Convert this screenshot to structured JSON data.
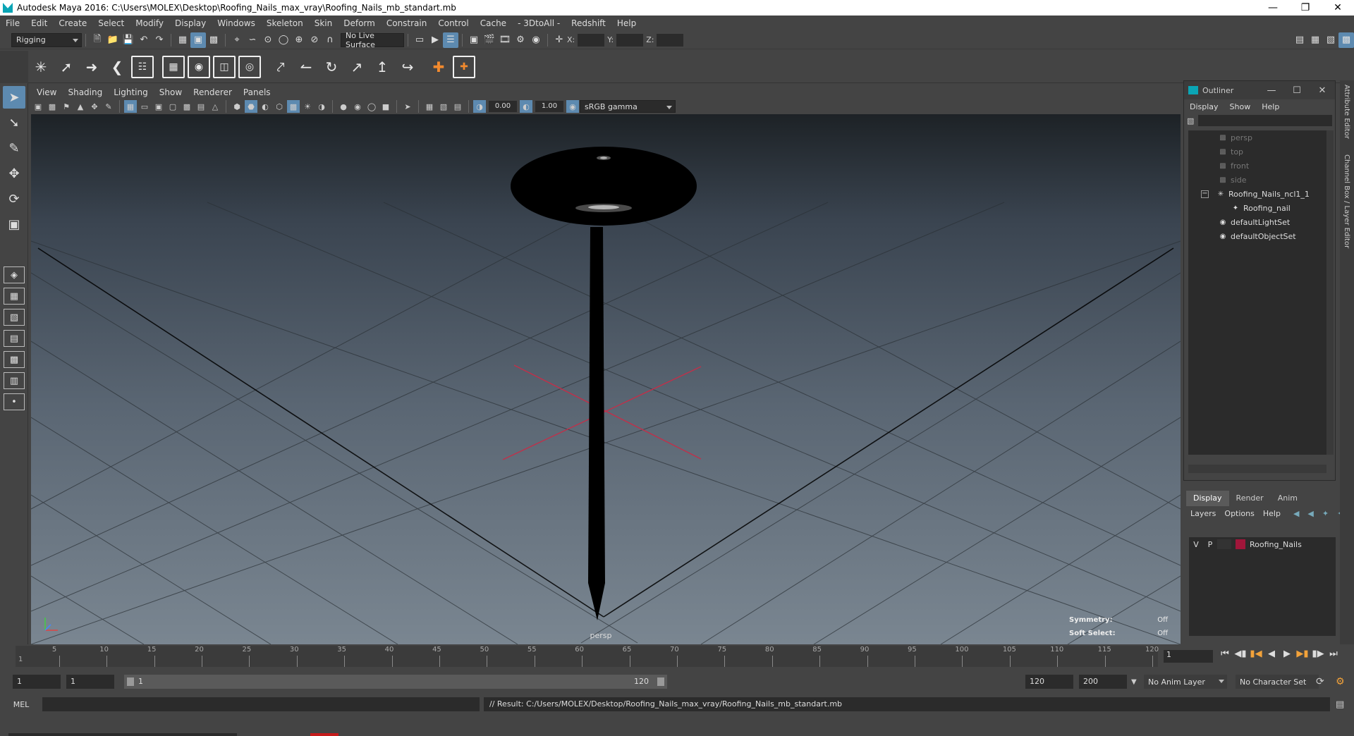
{
  "window": {
    "title": "Autodesk Maya 2016: C:\\Users\\MOLEX\\Desktop\\Roofing_Nails_max_vray\\Roofing_Nails_mb_standart.mb"
  },
  "menubar": [
    "File",
    "Edit",
    "Create",
    "Select",
    "Modify",
    "Display",
    "Windows",
    "Skeleton",
    "Skin",
    "Deform",
    "Constrain",
    "Control",
    "Cache",
    "- 3DtoAll -",
    "Redshift",
    "Help"
  ],
  "statusline": {
    "menuset": "Rigging",
    "live_surface": "No Live Surface",
    "x_label": "X:",
    "y_label": "Y:",
    "z_label": "Z:"
  },
  "panel": {
    "menus": [
      "View",
      "Shading",
      "Lighting",
      "Show",
      "Renderer",
      "Panels"
    ],
    "exposure": "0.00",
    "gamma": "1.00",
    "color_space": "sRGB gamma",
    "camera_label": "persp",
    "hud": {
      "symmetry_label": "Symmetry:",
      "symmetry_value": "Off",
      "soft_select_label": "Soft Select:",
      "soft_select_value": "Off"
    }
  },
  "outliner": {
    "title": "Outliner",
    "menus": [
      "Display",
      "Show",
      "Help"
    ],
    "items": [
      {
        "label": "persp",
        "icon": "camera-icon"
      },
      {
        "label": "top",
        "icon": "camera-icon"
      },
      {
        "label": "front",
        "icon": "camera-icon"
      },
      {
        "label": "side",
        "icon": "camera-icon"
      },
      {
        "label": "Roofing_Nails_ncl1_1",
        "icon": "group-icon"
      },
      {
        "label": "Roofing_nail",
        "icon": "mesh-icon"
      },
      {
        "label": "defaultLightSet",
        "icon": "set-icon"
      },
      {
        "label": "defaultObjectSet",
        "icon": "set-icon"
      }
    ]
  },
  "layer_editor": {
    "tabs": [
      "Display",
      "Render",
      "Anim"
    ],
    "menus": [
      "Layers",
      "Options",
      "Help"
    ],
    "layers": [
      {
        "v": "V",
        "p": "P",
        "name": "Roofing_Nails",
        "color": "#a0163a"
      }
    ]
  },
  "side_tabs": [
    "Attribute Editor",
    "Channel Box / Layer Editor"
  ],
  "timeslider": {
    "ticks": [
      "5",
      "10",
      "15",
      "20",
      "25",
      "30",
      "35",
      "40",
      "45",
      "50",
      "55",
      "60",
      "65",
      "70",
      "75",
      "80",
      "85",
      "90",
      "95",
      "100",
      "105",
      "110",
      "115",
      "120"
    ],
    "start_tick": "1",
    "current_frame": "1"
  },
  "range": {
    "start": "1",
    "start2": "1",
    "slider_start": "1",
    "slider_end": "120",
    "end": "120",
    "end2": "200",
    "anim_layer": "No Anim Layer",
    "character_set": "No Character Set"
  },
  "cmdline": {
    "lang": "MEL",
    "result": "// Result: C:/Users/MOLEX/Desktop/Roofing_Nails_max_vray/Roofing_Nails_mb_standart.mb"
  }
}
